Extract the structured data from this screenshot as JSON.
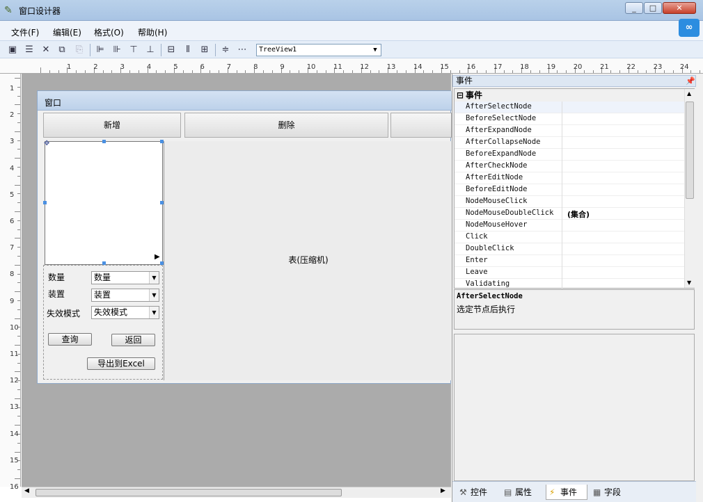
{
  "window": {
    "title": "窗口设计器",
    "minimize": "_",
    "maximize": "□",
    "close": "✕"
  },
  "menu": [
    "文件(F)",
    "编辑(E)",
    "格式(O)",
    "帮助(H)"
  ],
  "toolbar": {
    "combo_value": "TreeView1"
  },
  "ruler": {
    "h_labels": [
      "1",
      "2",
      "3",
      "4",
      "5",
      "6",
      "7",
      "8",
      "9",
      "10",
      "11",
      "12",
      "13",
      "14",
      "15",
      "16",
      "17",
      "18",
      "19",
      "20",
      "21",
      "22",
      "23",
      "24"
    ],
    "v_labels": [
      "1",
      "2",
      "3",
      "4",
      "5",
      "6",
      "7",
      "8",
      "9",
      "10",
      "11",
      "12",
      "13",
      "14",
      "15",
      "16"
    ]
  },
  "form": {
    "title": "窗口",
    "buttons": [
      "新增",
      "删除",
      ""
    ],
    "table_label": "表(压缩机)",
    "fields": [
      {
        "label": "数量",
        "value": "数量"
      },
      {
        "label": "装置",
        "value": "装置"
      },
      {
        "label": "失效模式",
        "value": "失效模式"
      }
    ],
    "query_label": "查询",
    "back_label": "返回",
    "export_label": "导出到Excel"
  },
  "panel": {
    "header": "事件",
    "category": "事件",
    "events": [
      {
        "name": "AfterSelectNode",
        "value": ""
      },
      {
        "name": "BeforeSelectNode",
        "value": ""
      },
      {
        "name": "AfterExpandNode",
        "value": ""
      },
      {
        "name": "AfterCollapseNode",
        "value": ""
      },
      {
        "name": "BeforeExpandNode",
        "value": ""
      },
      {
        "name": "AfterCheckNode",
        "value": ""
      },
      {
        "name": "AfterEditNode",
        "value": ""
      },
      {
        "name": "BeforeEditNode",
        "value": ""
      },
      {
        "name": "NodeMouseClick",
        "value": ""
      },
      {
        "name": "NodeMouseDoubleClick",
        "value": "(集合)"
      },
      {
        "name": "NodeMouseHover",
        "value": ""
      },
      {
        "name": "Click",
        "value": ""
      },
      {
        "name": "DoubleClick",
        "value": ""
      },
      {
        "name": "Enter",
        "value": ""
      },
      {
        "name": "Leave",
        "value": ""
      },
      {
        "name": "Validating",
        "value": ""
      }
    ],
    "desc_title": "AfterSelectNode",
    "desc_text": "选定节点后执行",
    "tabs": [
      "控件",
      "属性",
      "事件",
      "字段"
    ]
  }
}
